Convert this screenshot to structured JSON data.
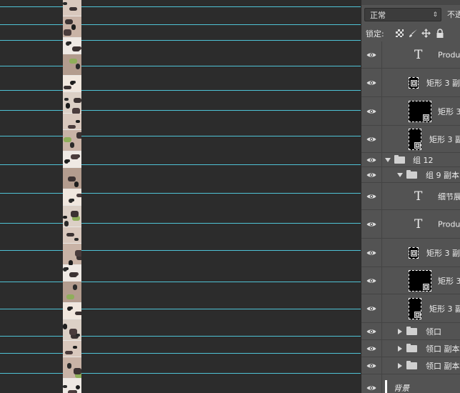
{
  "blend": {
    "mode": "正常",
    "opacity_label": "不透"
  },
  "lock": {
    "label": "锁定:"
  },
  "icons": {
    "eye": "eye-icon",
    "text_layer": "T",
    "dropdown_arrow": "⇕",
    "lock_brush": "brush-icon",
    "lock_move": "move-icon",
    "lock_all": "lock-icon"
  },
  "colors": {
    "guide": "#4fc3d6",
    "panel": "#535353",
    "canvas": "#2c2c2c"
  },
  "layers": [
    {
      "name": "Produc",
      "kind": "text"
    },
    {
      "name": "矩形 3 副",
      "kind": "shape-small"
    },
    {
      "name": "矩形 3",
      "kind": "shape-large"
    },
    {
      "name": "矩形 3 副",
      "kind": "shape-tall"
    },
    {
      "name": "组 12",
      "kind": "group-open"
    },
    {
      "name": "组 9 副本",
      "kind": "group-open-nested"
    },
    {
      "name": "细节展",
      "kind": "text"
    },
    {
      "name": "Produc",
      "kind": "text"
    },
    {
      "name": "矩形 3 副",
      "kind": "shape-small"
    },
    {
      "name": "矩形 3",
      "kind": "shape-large"
    },
    {
      "name": "矩形 3 副",
      "kind": "shape-tall"
    },
    {
      "name": "领口",
      "kind": "group-closed"
    },
    {
      "name": "领口 副本",
      "kind": "group-closed"
    },
    {
      "name": "领口 副本",
      "kind": "group-closed"
    },
    {
      "name": "背景",
      "kind": "background"
    }
  ]
}
